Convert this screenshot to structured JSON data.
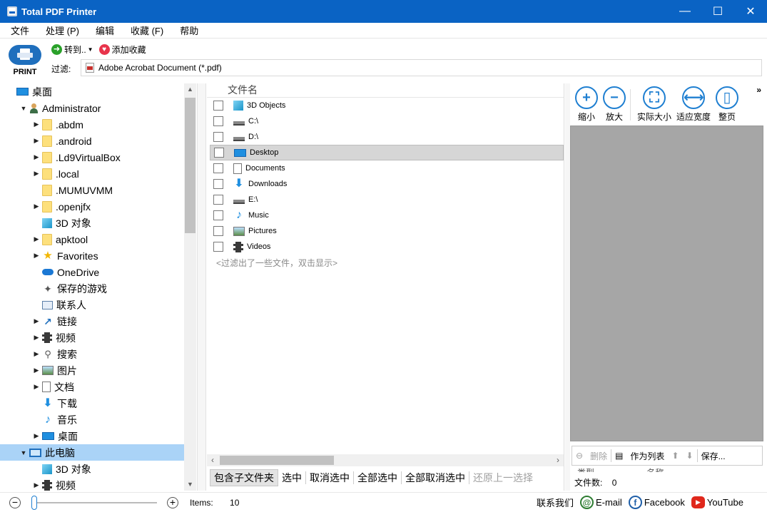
{
  "window": {
    "title": "Total PDF Printer",
    "controls": [
      "—",
      "☐",
      "✕"
    ]
  },
  "menu": [
    "文件",
    "处理 (P)",
    "编辑",
    "收藏 (F)",
    "帮助"
  ],
  "toolbar": {
    "print_label": "PRINT",
    "goto_label": "转到..",
    "add_favorite_label": "添加收藏",
    "filter_label": "过滤:",
    "filter_value": "Adobe Acrobat Document (*.pdf)"
  },
  "tree": [
    {
      "label": "桌面",
      "icon": "desktop-icon",
      "indent": 0,
      "expander": "",
      "selected": false
    },
    {
      "label": "Administrator",
      "icon": "user-icon",
      "indent": 1,
      "expander": "▼",
      "selected": false
    },
    {
      "label": ".abdm",
      "icon": "folder-icon",
      "indent": 2,
      "expander": "▶",
      "selected": false
    },
    {
      "label": ".android",
      "icon": "folder-icon",
      "indent": 2,
      "expander": "▶",
      "selected": false
    },
    {
      "label": ".Ld9VirtualBox",
      "icon": "folder-icon",
      "indent": 2,
      "expander": "▶",
      "selected": false
    },
    {
      "label": ".local",
      "icon": "folder-icon",
      "indent": 2,
      "expander": "▶",
      "selected": false
    },
    {
      "label": ".MUMUVMM",
      "icon": "folder-icon",
      "indent": 2,
      "expander": "",
      "selected": false
    },
    {
      "label": ".openjfx",
      "icon": "folder-icon",
      "indent": 2,
      "expander": "▶",
      "selected": false
    },
    {
      "label": "3D 对象",
      "icon": "cube-icon",
      "indent": 2,
      "expander": "",
      "selected": false
    },
    {
      "label": "apktool",
      "icon": "folder-icon",
      "indent": 2,
      "expander": "▶",
      "selected": false
    },
    {
      "label": "Favorites",
      "icon": "star-icon",
      "indent": 2,
      "expander": "▶",
      "selected": false
    },
    {
      "label": "OneDrive",
      "icon": "cloud-icon",
      "indent": 2,
      "expander": "",
      "selected": false
    },
    {
      "label": "保存的游戏",
      "icon": "game-icon",
      "indent": 2,
      "expander": "",
      "selected": false
    },
    {
      "label": "联系人",
      "icon": "contact-icon",
      "indent": 2,
      "expander": "",
      "selected": false
    },
    {
      "label": "链接",
      "icon": "link-icon",
      "indent": 2,
      "expander": "▶",
      "selected": false
    },
    {
      "label": "视频",
      "icon": "film-icon",
      "indent": 2,
      "expander": "▶",
      "selected": false
    },
    {
      "label": "搜索",
      "icon": "search-icon",
      "indent": 2,
      "expander": "▶",
      "selected": false
    },
    {
      "label": "图片",
      "icon": "picture-icon",
      "indent": 2,
      "expander": "▶",
      "selected": false
    },
    {
      "label": "文档",
      "icon": "document-icon",
      "indent": 2,
      "expander": "▶",
      "selected": false
    },
    {
      "label": "下载",
      "icon": "download-icon",
      "indent": 2,
      "expander": "",
      "selected": false
    },
    {
      "label": "音乐",
      "icon": "music-icon",
      "indent": 2,
      "expander": "",
      "selected": false
    },
    {
      "label": "桌面",
      "icon": "desktop-icon",
      "indent": 2,
      "expander": "▶",
      "selected": false
    },
    {
      "label": "此电脑",
      "icon": "computer-icon",
      "indent": 1,
      "expander": "▼",
      "selected": true
    },
    {
      "label": "3D 对象",
      "icon": "cube-icon",
      "indent": 2,
      "expander": "",
      "selected": false
    },
    {
      "label": "视频",
      "icon": "film-icon",
      "indent": 2,
      "expander": "▶",
      "selected": false
    }
  ],
  "files": {
    "column_header": "文件名",
    "rows": [
      {
        "name": "3D Objects",
        "icon": "cube-icon",
        "selected": false
      },
      {
        "name": "C:\\",
        "icon": "drive-icon",
        "selected": false
      },
      {
        "name": "D:\\",
        "icon": "drive-icon",
        "selected": false
      },
      {
        "name": "Desktop",
        "icon": "desktop-icon",
        "selected": true
      },
      {
        "name": "Documents",
        "icon": "document-icon",
        "selected": false
      },
      {
        "name": "Downloads",
        "icon": "download-icon",
        "selected": false
      },
      {
        "name": "E:\\",
        "icon": "drive-icon",
        "selected": false
      },
      {
        "name": "Music",
        "icon": "music-icon",
        "selected": false
      },
      {
        "name": "Pictures",
        "icon": "picture-icon",
        "selected": false
      },
      {
        "name": "Videos",
        "icon": "film-icon",
        "selected": false
      }
    ],
    "filtered_note": "<过滤出了一些文件，双击显示>",
    "actions": {
      "include_subfolders": "包含子文件夹",
      "select": "选中",
      "deselect": "取消选中",
      "select_all": "全部选中",
      "deselect_all": "全部取消选中",
      "undo_selection": "还原上一选择"
    }
  },
  "preview": {
    "tools": [
      {
        "label": "缩小",
        "glyph": "+",
        "icon": "zoom-in-icon"
      },
      {
        "label": "放大",
        "glyph": "−",
        "icon": "zoom-out-icon"
      },
      {
        "label": "实际大小",
        "glyph": "⛶",
        "icon": "actual-size-icon"
      },
      {
        "label": "适应宽度",
        "glyph": "⟷",
        "icon": "fit-width-icon"
      },
      {
        "label": "整页",
        "glyph": "▯",
        "icon": "full-page-icon"
      }
    ],
    "more": "»",
    "delete_label": "删除",
    "as_list_label": "作为列表",
    "save_label": "保存...",
    "col_type": "类型",
    "col_name": "名称",
    "file_count_label": "文件数:",
    "file_count": "0"
  },
  "status": {
    "items_label": "Items:",
    "items_count": "10",
    "contact": "联系我们",
    "email": "E-mail",
    "facebook": "Facebook",
    "youtube": "YouTube"
  },
  "colors": {
    "titlebar": "#0a63c4",
    "accent": "#1f7fd1",
    "selection": "#aad3f7"
  }
}
